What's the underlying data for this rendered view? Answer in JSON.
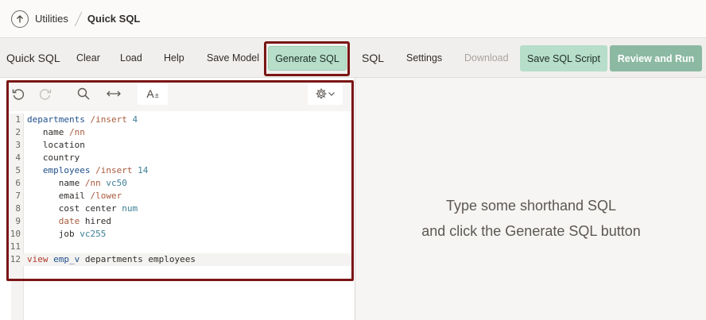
{
  "breadcrumb": {
    "parent": "Utilities",
    "current": "Quick SQL"
  },
  "toolbar": {
    "app_title": "Quick SQL",
    "clear": "Clear",
    "load": "Load",
    "help": "Help",
    "save_model": "Save Model",
    "generate_sql": "Generate SQL",
    "sql": "SQL",
    "settings": "Settings",
    "download": "Download",
    "save_sql_script": "Save SQL Script",
    "review_and_run": "Review and Run"
  },
  "editor": {
    "tools": {
      "font_label": "A",
      "font_sub": "±"
    },
    "lines": [
      {
        "n": "1",
        "tokens": [
          {
            "t": "departments",
            "c": "kw"
          },
          {
            "t": " /insert",
            "c": "dir"
          },
          {
            "t": " 4",
            "c": "ty"
          }
        ]
      },
      {
        "n": "2",
        "tokens": [
          {
            "t": "   name",
            "c": "plain"
          },
          {
            "t": " /nn",
            "c": "dir"
          }
        ]
      },
      {
        "n": "3",
        "tokens": [
          {
            "t": "   location",
            "c": "plain"
          }
        ]
      },
      {
        "n": "4",
        "tokens": [
          {
            "t": "   country",
            "c": "plain"
          }
        ]
      },
      {
        "n": "5",
        "tokens": [
          {
            "t": "   employees",
            "c": "kw"
          },
          {
            "t": " /insert",
            "c": "dir"
          },
          {
            "t": " 14",
            "c": "ty"
          }
        ]
      },
      {
        "n": "6",
        "tokens": [
          {
            "t": "      name",
            "c": "plain"
          },
          {
            "t": " /nn",
            "c": "dir"
          },
          {
            "t": " vc50",
            "c": "ty"
          }
        ]
      },
      {
        "n": "7",
        "tokens": [
          {
            "t": "      email",
            "c": "plain"
          },
          {
            "t": " /lower",
            "c": "dir"
          }
        ]
      },
      {
        "n": "8",
        "tokens": [
          {
            "t": "      cost center",
            "c": "plain"
          },
          {
            "t": " num",
            "c": "ty"
          }
        ]
      },
      {
        "n": "9",
        "tokens": [
          {
            "t": "      ",
            "c": "plain"
          },
          {
            "t": "date",
            "c": "dir"
          },
          {
            "t": " hired",
            "c": "plain"
          }
        ]
      },
      {
        "n": "10",
        "tokens": [
          {
            "t": "      job",
            "c": "plain"
          },
          {
            "t": " vc255",
            "c": "ty"
          }
        ]
      },
      {
        "n": "11",
        "tokens": []
      },
      {
        "n": "12",
        "tokens": [
          {
            "t": "view",
            "c": "vw"
          },
          {
            "t": " emp_v",
            "c": "kw"
          },
          {
            "t": " departments employees",
            "c": "plain"
          }
        ],
        "active": true
      }
    ]
  },
  "output": {
    "line1": "Type some shorthand SQL",
    "line2": "and click the Generate SQL button"
  },
  "colors": {
    "accent_green": "#b6dec9",
    "review_green": "#8cb9a2",
    "highlight_frame": "#7a1515"
  }
}
